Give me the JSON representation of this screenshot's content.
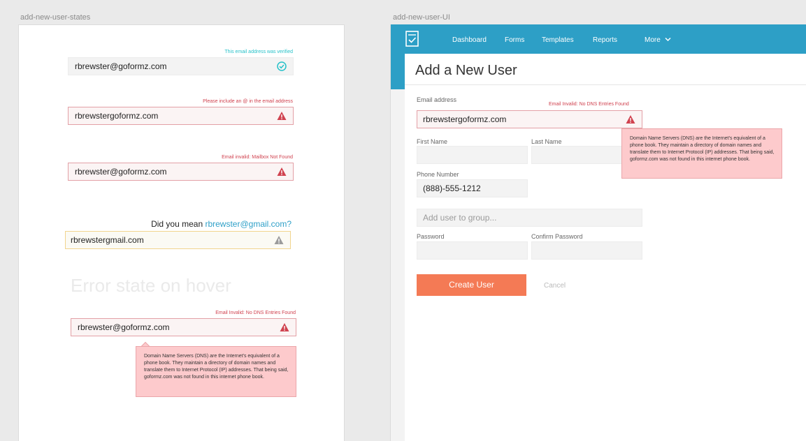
{
  "artboards": {
    "states_label": "add-new-user-states",
    "ui_label": "add-new-user-UI"
  },
  "states": {
    "verified": {
      "note": "This email address was verified",
      "value": "rbrewster@goformz.com"
    },
    "missing_at": {
      "note": "Please include an @ in the email address",
      "value": "rbrewstergoformz.com"
    },
    "mailbox": {
      "note": "Email invalid: Mailbox Not Found",
      "value": "rbrewster@goformz.com"
    },
    "suggestion": {
      "prefix": "Did you mean ",
      "link": "rbrewster@gmail.com?",
      "value": "rbrewstergmail.com"
    },
    "hover": {
      "title": "Error state on hover",
      "note": "Email Invalid: No DNS Entries Found",
      "value": "rbrewster@goformz.com",
      "tooltip": "Domain Name Servers (DNS) are the Internet's equivalent of a phone book. They maintain a directory of domain names and translate them to Internet Protocol (IP) addresses. That being said, goformz.com was not found in this internet phone book."
    }
  },
  "ui": {
    "nav": [
      "Dashboard",
      "Forms",
      "Templates",
      "Reports",
      "More"
    ],
    "title": "Add a New User",
    "email_label": "Email address",
    "email_error": "Email Invalid: No DNS Entries Found",
    "email_value": "rbrewstergoformz.com",
    "tooltip": "Domain Name Servers (DNS) are the Internet's equivalent of a phone book. They maintain a directory of domain names and translate them to Internet Protocol (IP) addresses. That being said, goformz.com was not found in this internet phone book.",
    "first_name_label": "First Name",
    "last_name_label": "Last Name",
    "phone_label": "Phone Number",
    "phone_value": "(888)-555-1212",
    "group_placeholder": "Add user to group...",
    "password_label": "Password",
    "confirm_password_label": "Confirm Password",
    "create_button": "Create User",
    "cancel_button": "Cancel"
  },
  "colors": {
    "brand": "#2d9fc6",
    "success": "#26c1c9",
    "error": "#d0424f",
    "warning": "#f1d48e",
    "cta": "#f47a55",
    "tooltip_bg": "#fdcacc"
  },
  "icons": [
    "check-circle-icon",
    "warning-triangle-icon",
    "form-logo-icon",
    "chevron-down-icon"
  ]
}
